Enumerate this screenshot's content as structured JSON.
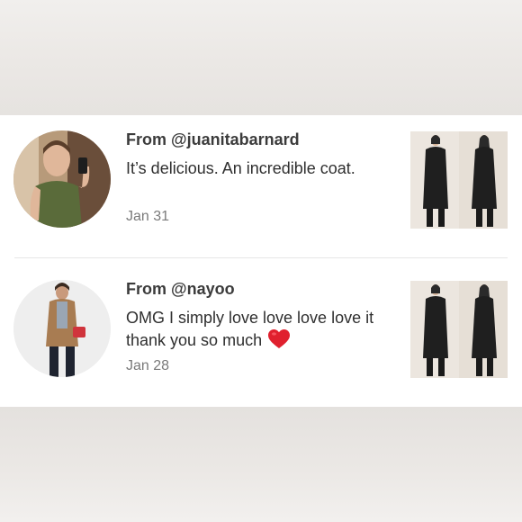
{
  "reviews": [
    {
      "from_prefix": "From ",
      "username": "@juanitabarnard",
      "message": "It’s delicious. An incredible coat.",
      "date": "Jan 31",
      "avatar_icon": "user-avatar-photo",
      "product_icon": "black-coat-product-photo"
    },
    {
      "from_prefix": "From ",
      "username": "@nayoo",
      "message": "OMG I simply love love love love it thank you so much",
      "emoji": "red-heart-icon",
      "date": "Jan 28",
      "avatar_icon": "user-avatar-photo",
      "product_icon": "black-coat-product-photo"
    }
  ],
  "colors": {
    "text_primary": "#2f2f2f",
    "text_secondary": "#7a7a7a",
    "divider": "#e6e6e6",
    "heart": "#e0202e"
  }
}
